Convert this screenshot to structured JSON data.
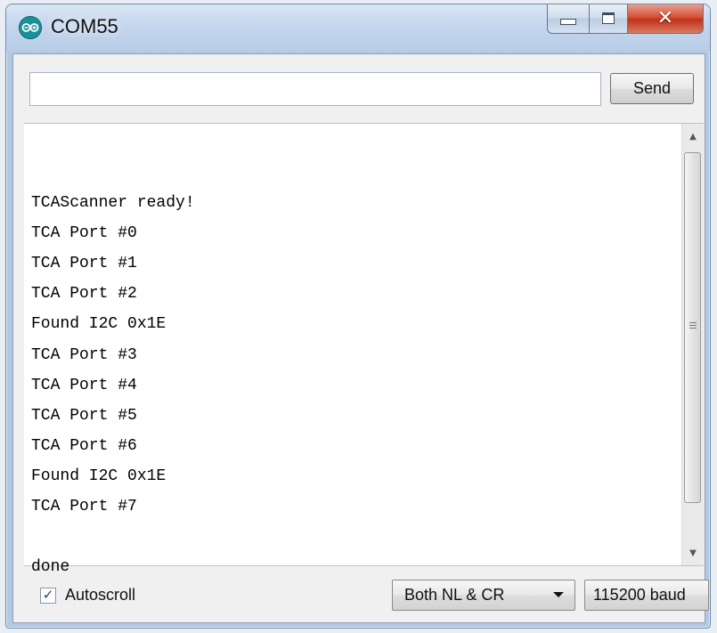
{
  "window": {
    "title": "COM55",
    "icon": "arduino-icon",
    "close_glyph": "✕"
  },
  "send_bar": {
    "input_value": "",
    "input_placeholder": "",
    "send_label": "Send"
  },
  "output": {
    "lines": [
      "",
      "TCAScanner ready!",
      "TCA Port #0",
      "TCA Port #1",
      "TCA Port #2",
      "Found I2C 0x1E",
      "TCA Port #3",
      "TCA Port #4",
      "TCA Port #5",
      "TCA Port #6",
      "Found I2C 0x1E",
      "TCA Port #7",
      "",
      "done"
    ]
  },
  "footer": {
    "autoscroll_label": "Autoscroll",
    "autoscroll_checked": true,
    "line_ending_value": "Both NL & CR",
    "baud_value": "115200 baud"
  },
  "colors": {
    "titlebar": "#c3d5ec",
    "close_button": "#c8402a",
    "app_icon": "#19919a"
  }
}
